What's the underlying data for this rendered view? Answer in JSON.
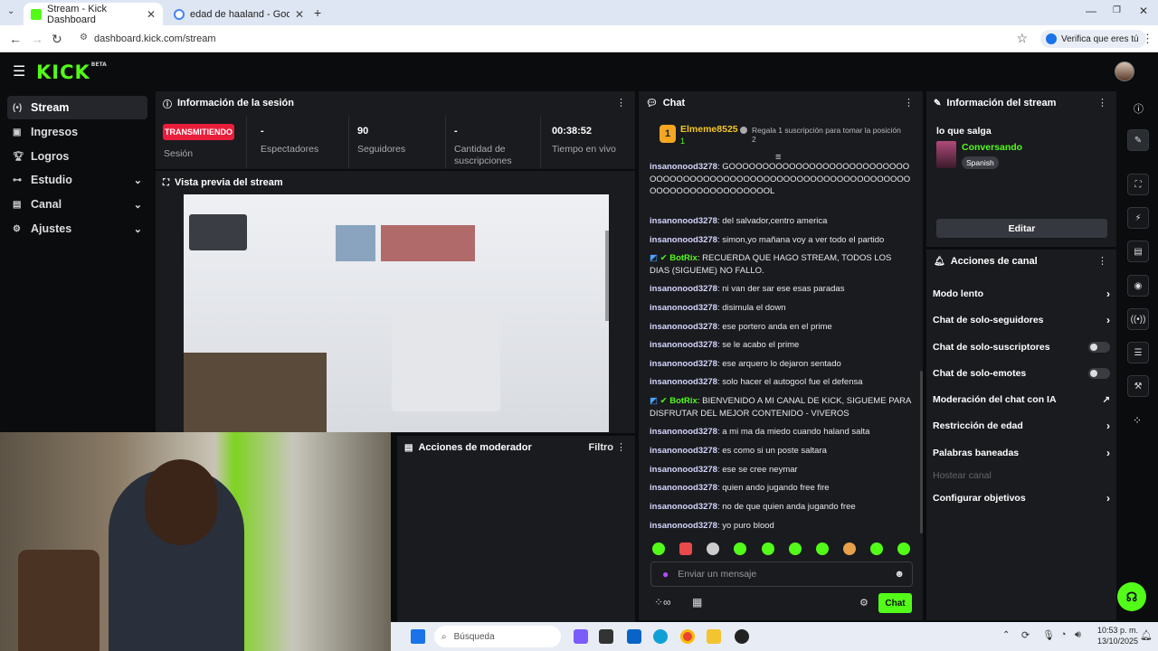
{
  "browser": {
    "tabs": [
      {
        "title": "Stream - Kick Dashboard",
        "active": true
      },
      {
        "title": "edad de haaland - Google Sear",
        "active": false
      }
    ],
    "url": "dashboard.kick.com/stream",
    "verify_label": "Verifica que eres tú"
  },
  "app": {
    "logo": "KICK",
    "logo_badge": "BETA"
  },
  "sidebar": {
    "items": [
      {
        "label": "Stream",
        "icon": "stream-icon",
        "active": true
      },
      {
        "label": "Ingresos",
        "icon": "wallet-icon"
      },
      {
        "label": "Logros",
        "icon": "trophy-icon"
      },
      {
        "label": "Estudio",
        "icon": "studio-icon",
        "expandable": true
      },
      {
        "label": "Canal",
        "icon": "channel-icon",
        "expandable": true
      },
      {
        "label": "Ajustes",
        "icon": "gear-icon",
        "expandable": true
      }
    ]
  },
  "session": {
    "title": "Información de la sesión",
    "live_badge": "TRANSMITIENDO",
    "session_label": "Sesión",
    "stats": [
      {
        "value": "-",
        "label": "Espectadores"
      },
      {
        "value": "90",
        "label": "Seguidores"
      },
      {
        "value": "-",
        "label": "Cantidad de suscripciones"
      },
      {
        "value": "00:38:52",
        "label": "Tiempo en vivo"
      }
    ]
  },
  "preview": {
    "title": "Vista previa del stream"
  },
  "modactions": {
    "title": "Acciones de moderador",
    "filter_label": "Filtro"
  },
  "chat": {
    "title": "Chat",
    "leader": {
      "rank": "1",
      "name": "Elmeme8525",
      "count": "1"
    },
    "gift_text": "Regala 1 suscripción para tomar la posición 2",
    "messages": [
      {
        "user": "insanonood3278",
        "text": "GOOOOOOOOOOOOOOOOOOOOOOOOOOOOOOOOOOOOOOOOOOOOOOOOOOOOOOOOOOOOOOOOOOOOOOOOOOOOOOOOOOOOL"
      },
      {
        "user": "insanonood3278",
        "text": "del salvador,centro america"
      },
      {
        "user": "insanonood3278",
        "text": "simon,yo mañana voy a ver todo el partido"
      },
      {
        "user": "BotRix",
        "bot": true,
        "text": "RECUERDA QUE HAGO STREAM, TODOS LOS DIAS (SIGUEME) NO FALLO."
      },
      {
        "user": "insanonood3278",
        "text": "ni van der sar ese esas paradas"
      },
      {
        "user": "insanonood3278",
        "text": "disimula el down"
      },
      {
        "user": "insanonood3278",
        "text": "ese portero anda en el prime"
      },
      {
        "user": "insanonood3278",
        "text": "se le acabo el prime"
      },
      {
        "user": "insanonood3278",
        "text": "ese arquero lo dejaron sentado"
      },
      {
        "user": "insanonood3278",
        "text": "solo hacer el autogool fue el defensa"
      },
      {
        "user": "BotRix",
        "bot": true,
        "text": "BIENVENIDO A MI CANAL DE KICK, SIGUEME PARA DISFRUTAR DEL MEJOR CONTENIDO - VIVEROS"
      },
      {
        "user": "insanonood3278",
        "text": "a mi ma da miedo cuando haland salta"
      },
      {
        "user": "insanonood3278",
        "text": "es como si un poste saltara"
      },
      {
        "user": "insanonood3278",
        "text": "ese se cree neymar"
      },
      {
        "user": "insanonood3278",
        "text": "quien ando jugando free fire"
      },
      {
        "user": "insanonood3278",
        "text": "no de que quien anda jugando free"
      },
      {
        "user": "insanonood3278",
        "text": "yo puro blood"
      }
    ],
    "input_placeholder": "Enviar un mensaje",
    "send_label": "Chat"
  },
  "stream_info": {
    "title": "Información del stream",
    "stream_title": "lo que salga",
    "category": "Conversando",
    "language": "Spanish",
    "edit_label": "Editar"
  },
  "channel_actions": {
    "title": "Acciones de canal",
    "items": [
      {
        "label": "Modo lento",
        "control": "chevron"
      },
      {
        "label": "Chat de solo-seguidores",
        "control": "chevron"
      },
      {
        "label": "Chat de solo-suscriptores",
        "control": "toggle"
      },
      {
        "label": "Chat de solo-emotes",
        "control": "toggle"
      },
      {
        "label": "Moderación del chat con IA",
        "control": "external"
      },
      {
        "label": "Restricción de edad",
        "control": "chevron"
      },
      {
        "label": "Palabras baneadas",
        "control": "chevron"
      },
      {
        "label": "Hostear canal",
        "control": "none",
        "disabled": true
      },
      {
        "label": "Configurar objetivos",
        "control": "chevron"
      }
    ]
  },
  "taskbar": {
    "search_placeholder": "Búsqueda",
    "time": "10:53 p. m.",
    "date": "13/10/2025"
  },
  "colors": {
    "accent": "#53fc18",
    "live": "#e91e3c",
    "panel": "#191b1f",
    "bg": "#0b0c0e"
  }
}
